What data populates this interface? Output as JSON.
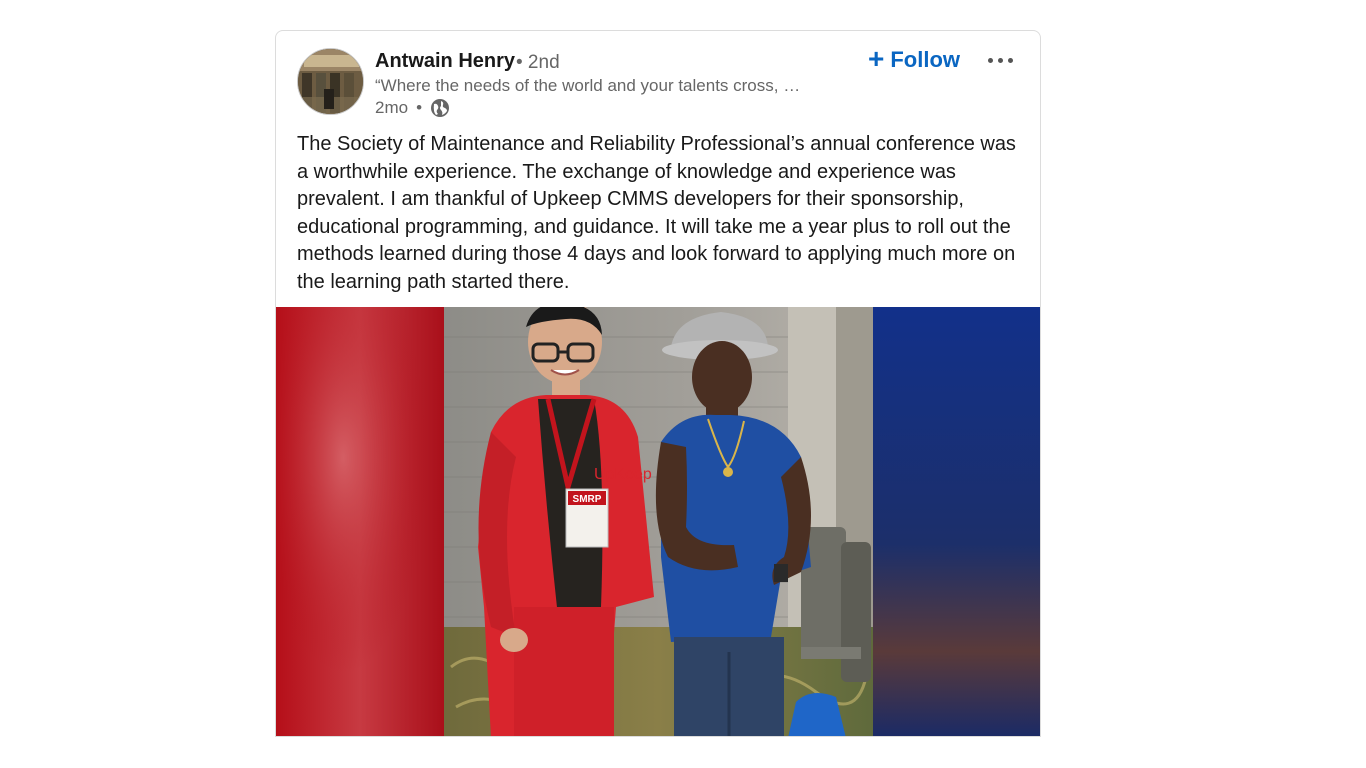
{
  "post": {
    "author": {
      "name": "Antwain Henry",
      "degree": "• 2nd",
      "headline": "“Where the needs of the world and your talents cross, …"
    },
    "meta": {
      "age": "2mo",
      "separator": "•",
      "visibility_icon": "globe-icon"
    },
    "actions": {
      "follow_label": "Follow",
      "follow_icon": "plus-icon",
      "more_icon": "ellipsis-icon"
    },
    "text": "The Society of Maintenance and Reliability Professional’s annual conference was a worthwhile experience. The exchange of knowledge and experience was prevalent. I am thankful of Upkeep CMMS developers for their sponsorship, educational programming, and guidance. It will take me a year plus to roll out the methods learned during those 4 days and look forward to applying much more on the learning path started there.",
    "image": {
      "jacket_logo_text": "UpKeep",
      "badge_text": "SMRP"
    }
  },
  "colors": {
    "accent": "#0a66c2",
    "text_primary": "#191919",
    "text_secondary": "#666666"
  }
}
